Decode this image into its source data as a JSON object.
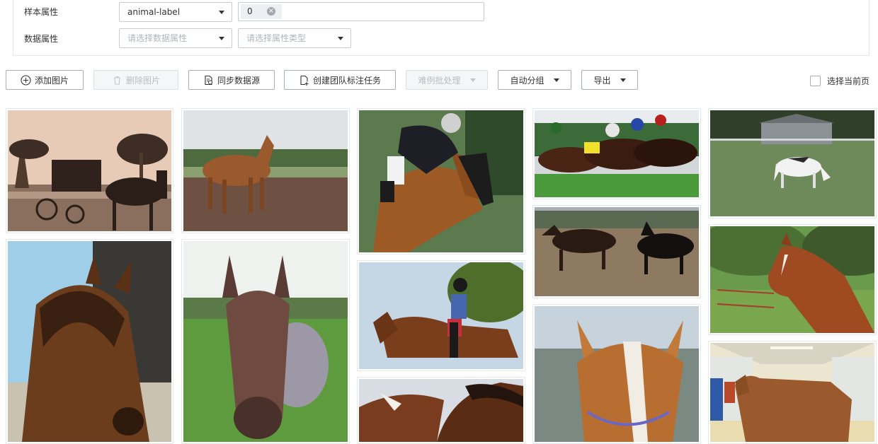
{
  "filters": {
    "sample_attr_label": "样本属性",
    "sample_attr_value": "animal-label",
    "sample_tag": "0",
    "data_attr_label": "数据属性",
    "data_attr_placeholder": "请选择数据属性",
    "attr_type_placeholder": "请选择属性类型"
  },
  "toolbar": {
    "add_image": "添加图片",
    "delete_image": "删除图片",
    "sync_source": "同步数据源",
    "create_team_task": "创建团队标注任务",
    "hard_case": "难例批处理",
    "auto_group": "自动分组",
    "export": "导出",
    "select_page": "选择当前页"
  },
  "colors": {
    "border": "#a9adb4",
    "disabled_bg": "#f5f6f7",
    "disabled_text": "#b8bcc2",
    "placeholder": "#b0b4bb"
  },
  "images": [
    {
      "subject": "horse-carriage-sepia"
    },
    {
      "subject": "chestnut-horse-paddock"
    },
    {
      "subject": "show-jumping-rider"
    },
    {
      "subject": "horse-race"
    },
    {
      "subject": "white-pony-grazing"
    },
    {
      "subject": "bay-horse-closeup"
    },
    {
      "subject": "horse-face-frontal"
    },
    {
      "subject": "girl-riding-bay-horse"
    },
    {
      "subject": "two-horses-running"
    },
    {
      "subject": "horse-head-profile"
    },
    {
      "subject": "two-bay-horses-closeup"
    },
    {
      "subject": "horse-blaze-face"
    },
    {
      "subject": "horse-in-stable-aisle"
    }
  ]
}
